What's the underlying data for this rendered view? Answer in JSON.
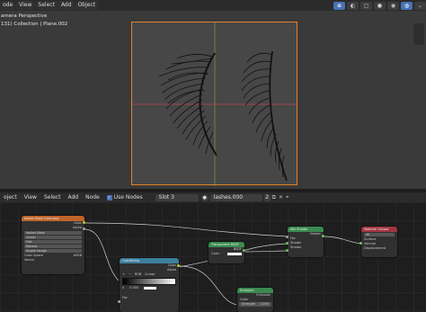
{
  "viewport_header": {
    "menus": [
      "ode",
      "View",
      "Select",
      "Add",
      "Object"
    ]
  },
  "viewport": {
    "camera_label": "amera Perspective",
    "collection_label": "131) Collection | Plane.002"
  },
  "node_header": {
    "mode": "oject",
    "menus": [
      "View",
      "Select",
      "Add",
      "Node"
    ],
    "use_nodes_label": "Use Nodes",
    "use_nodes_checked": true,
    "slot": "Slot 3",
    "material_name": "lashes.000",
    "user_count": "2"
  },
  "nodes": {
    "image_texture": {
      "title": "lashes Base Color.png",
      "out_color": "Color",
      "out_alpha": "Alpha",
      "image": "lashes Base",
      "interp": "Linear",
      "projection": "Flat",
      "extension": "Repeat",
      "source": "Single Image",
      "colorspace_label": "Color Space",
      "colorspace": "sRGB",
      "in_vector": "Vector"
    },
    "color_ramp": {
      "title": "ColorRamp",
      "out_color": "Color",
      "out_alpha": "Alpha",
      "mode": "RGB",
      "interp": "Linear",
      "pos": "0",
      "pos_value": "0.000",
      "in_fac": "Fac"
    },
    "transparent": {
      "title": "Transparent BSDF",
      "out_bsdf": "BSDF",
      "in_color": "Color"
    },
    "mix_shader": {
      "title": "Mix Shader",
      "out_shader": "Shader",
      "in_fac": "Fac",
      "in_shader1": "Shader",
      "in_shader2": "Shader"
    },
    "emission": {
      "title": "Emission",
      "out_emission": "Emission",
      "in_color": "Color",
      "in_strength": "Strength",
      "strength_value": "1.000"
    },
    "material_output": {
      "title": "Material Output",
      "target": "All",
      "in_surface": "Surface",
      "in_volume": "Volume",
      "in_displacement": "Displacement"
    }
  }
}
